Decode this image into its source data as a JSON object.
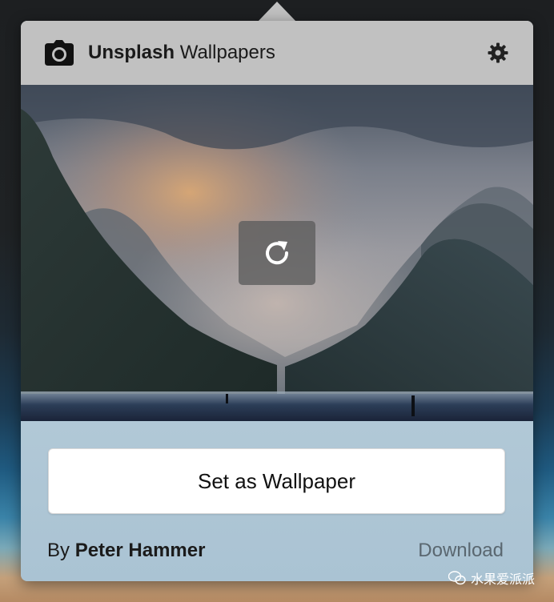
{
  "app": {
    "title_bold": "Unsplash",
    "title_rest": " Wallpapers",
    "header_icon": "camera-icon",
    "settings_icon": "gear-icon"
  },
  "photo": {
    "refresh_icon": "refresh-icon"
  },
  "actions": {
    "set_wallpaper_label": "Set as Wallpaper",
    "download_label": "Download"
  },
  "credit": {
    "prefix": "By ",
    "author": "Peter Hammer"
  },
  "watermark": {
    "text": "水果爱派派"
  },
  "colors": {
    "header_bg": "#c1c1c1",
    "footer_bg": "#b9cedb",
    "button_bg": "#ffffff",
    "download_text": "#5a6770"
  }
}
